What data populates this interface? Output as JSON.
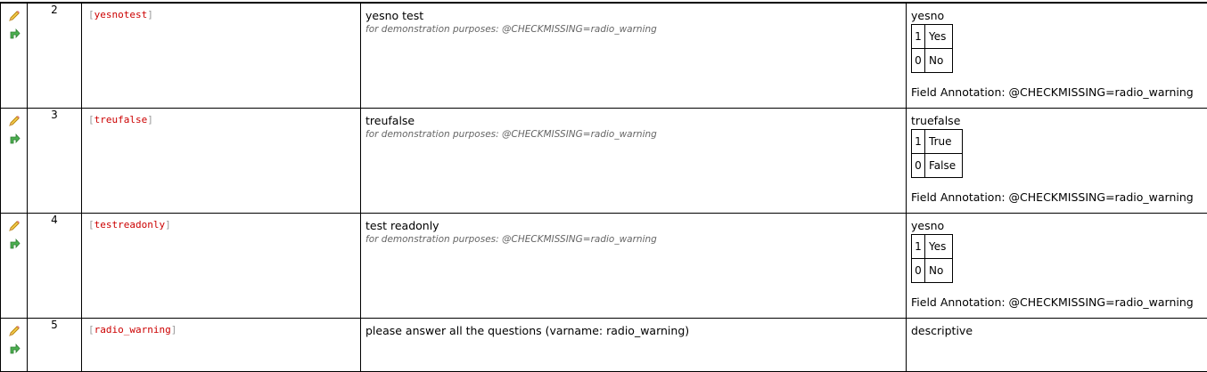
{
  "rows": [
    {
      "num": "2",
      "variable": "yesnotest",
      "label": "yesno test",
      "note": "for demonstration purposes: @CHECKMISSING=radio_warning",
      "type": "yesno",
      "choices": [
        {
          "value": "1",
          "label": "Yes"
        },
        {
          "value": "0",
          "label": "No"
        }
      ],
      "annotation": "Field Annotation: @CHECKMISSING=radio_warning"
    },
    {
      "num": "3",
      "variable": "treufalse",
      "label": "treufalse",
      "note": "for demonstration purposes: @CHECKMISSING=radio_warning",
      "type": "truefalse",
      "choices": [
        {
          "value": "1",
          "label": "True"
        },
        {
          "value": "0",
          "label": "False"
        }
      ],
      "annotation": "Field Annotation: @CHECKMISSING=radio_warning"
    },
    {
      "num": "4",
      "variable": "testreadonly",
      "label": "test readonly",
      "note": "for demonstration purposes: @CHECKMISSING=radio_warning",
      "type": "yesno",
      "choices": [
        {
          "value": "1",
          "label": "Yes"
        },
        {
          "value": "0",
          "label": "No"
        }
      ],
      "annotation": "Field Annotation: @CHECKMISSING=radio_warning"
    },
    {
      "num": "5",
      "variable": "radio_warning",
      "label": "please answer all the questions (varname: radio_warning)",
      "type": "descriptive"
    }
  ],
  "brackets": {
    "open": "[",
    "close": "]"
  },
  "icons": {
    "edit": "pencil-icon",
    "branch": "branching-arrow-icon"
  },
  "colors": {
    "varname": "#cc0000",
    "note": "#666666",
    "pencil": "#e0a020",
    "arrow": "#3a9a3a"
  }
}
